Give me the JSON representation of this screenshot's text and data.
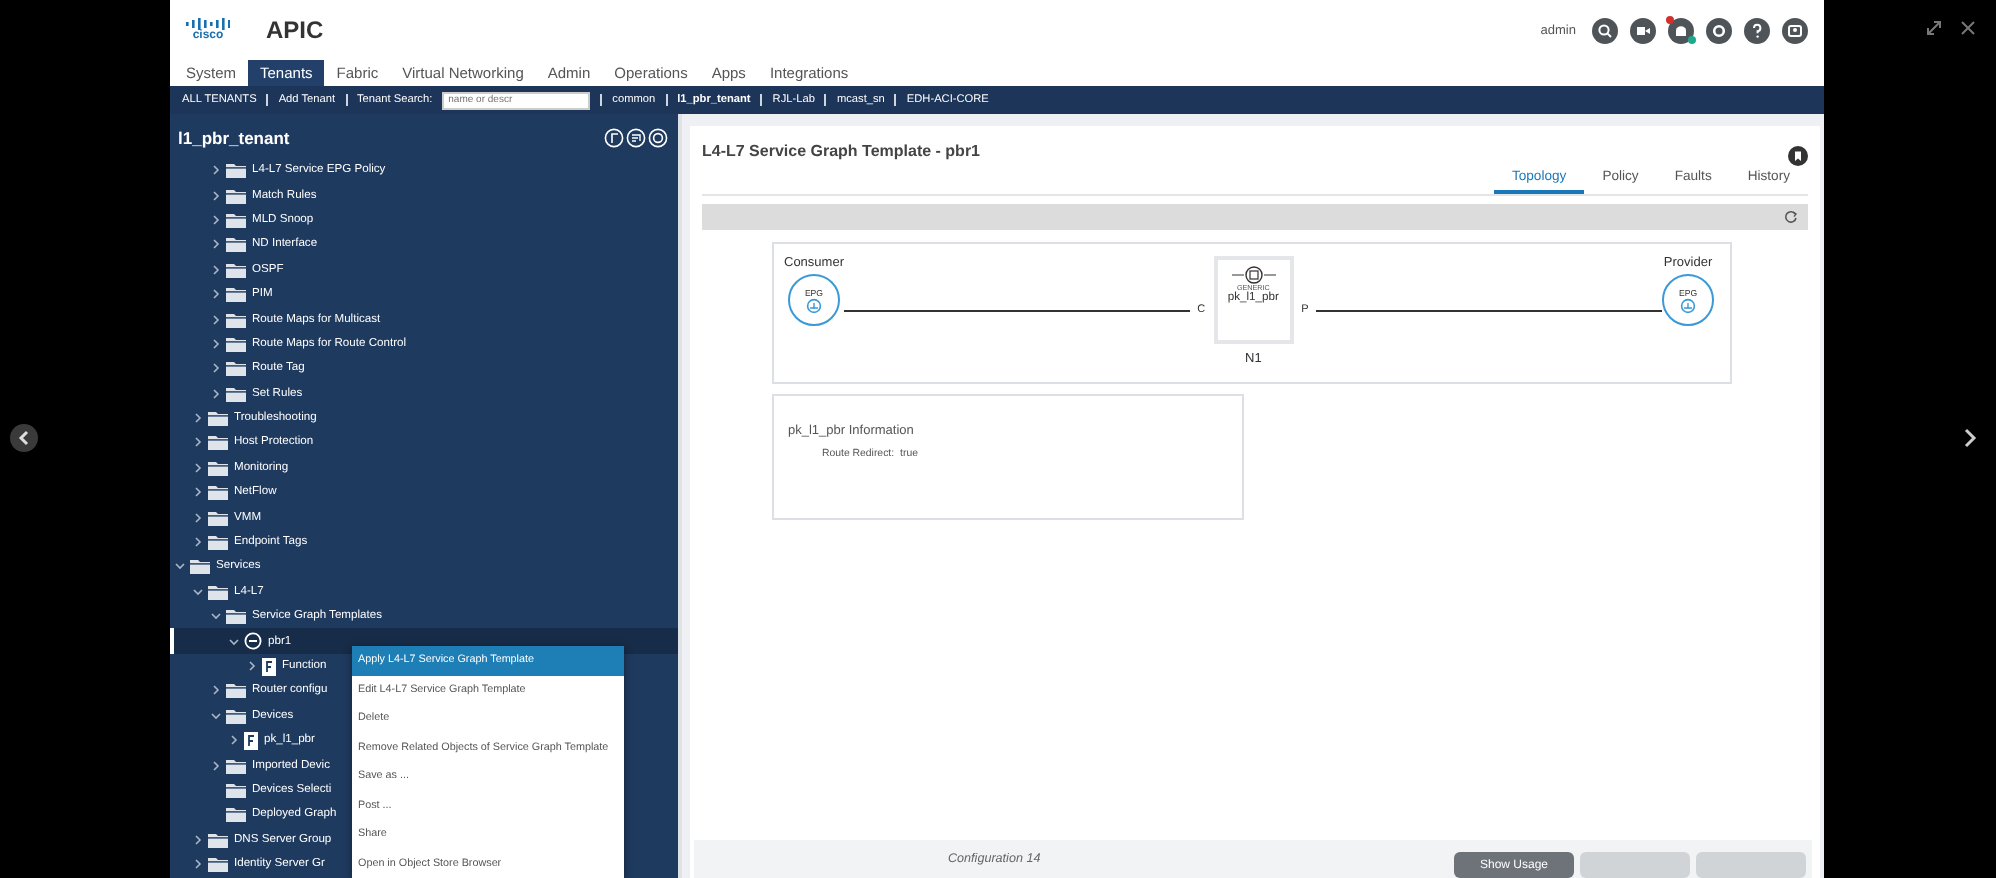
{
  "player": {
    "controls": [
      {
        "kind": "expand"
      },
      {
        "kind": "close"
      },
      {
        "kind": "previous"
      },
      {
        "kind": "next"
      }
    ]
  },
  "header": {
    "logo_text": "cisco",
    "product": "APIC",
    "user": "admin",
    "icons": [
      {
        "kind": "search"
      },
      {
        "kind": "video"
      },
      {
        "kind": "bell"
      },
      {
        "kind": "settings"
      },
      {
        "kind": "help"
      },
      {
        "kind": "user"
      }
    ]
  },
  "tabs": [
    {
      "label": "System",
      "selected": false
    },
    {
      "label": "Tenants",
      "selected": true
    },
    {
      "label": "Fabric",
      "selected": false
    },
    {
      "label": "Virtual Networking",
      "selected": false
    },
    {
      "label": "Admin",
      "selected": false
    },
    {
      "label": "Operations",
      "selected": false
    },
    {
      "label": "Apps",
      "selected": false
    },
    {
      "label": "Integrations",
      "selected": false
    }
  ],
  "tenant_bar": {
    "links": [
      {
        "label": "ALL TENANTS",
        "selected": false
      },
      {
        "label": "Add Tenant",
        "selected": false
      }
    ],
    "search_label": "Tenant Search:",
    "search_placeholder": "name or descr",
    "tenants": [
      {
        "label": "common",
        "selected": false
      },
      {
        "label": "l1_pbr_tenant",
        "selected": true
      },
      {
        "label": "RJL-Lab",
        "selected": false
      },
      {
        "label": "mcast_sn",
        "selected": false
      },
      {
        "label": "EDH-ACI-CORE",
        "selected": false
      }
    ]
  },
  "sidebar": {
    "title": "l1_pbr_tenant",
    "tree": [
      {
        "children": [
          {
            "children": [
              {
                "label": "L4-L7 Service EPG Policy",
                "kind": "folder",
                "expanded": false,
                "selected": false
              },
              {
                "label": "Match Rules",
                "kind": "folder",
                "expanded": false,
                "selected": false
              },
              {
                "label": "MLD Snoop",
                "kind": "folder",
                "expanded": false,
                "selected": false
              },
              {
                "label": "ND Interface",
                "kind": "folder",
                "expanded": false,
                "selected": false
              },
              {
                "label": "OSPF",
                "kind": "folder",
                "expanded": false,
                "selected": false
              },
              {
                "label": "PIM",
                "kind": "folder",
                "expanded": false,
                "selected": false
              },
              {
                "label": "Route Maps for Multicast",
                "kind": "folder",
                "expanded": false,
                "selected": false
              },
              {
                "label": "Route Maps for Route Control",
                "kind": "folder",
                "expanded": false,
                "selected": false
              },
              {
                "label": "Route Tag",
                "kind": "folder",
                "expanded": false,
                "selected": false
              },
              {
                "label": "Set Rules",
                "kind": "folder",
                "expanded": false,
                "selected": false
              }
            ]
          },
          {
            "label": "Troubleshooting",
            "kind": "folder",
            "expanded": false,
            "selected": false
          },
          {
            "label": "Host Protection",
            "kind": "folder",
            "expanded": false,
            "selected": false
          },
          {
            "label": "Monitoring",
            "kind": "folder",
            "expanded": false,
            "selected": false
          },
          {
            "label": "NetFlow",
            "kind": "folder",
            "expanded": false,
            "selected": false
          },
          {
            "label": "VMM",
            "kind": "folder",
            "expanded": false,
            "selected": false
          },
          {
            "label": "Endpoint Tags",
            "kind": "folder",
            "expanded": false,
            "selected": false
          }
        ]
      },
      {
        "label": "Services",
        "kind": "folder",
        "expanded": true,
        "selected": false,
        "children": [
          {
            "label": "L4-L7",
            "kind": "folder",
            "expanded": true,
            "selected": false,
            "children": [
              {
                "label": "Service Graph Templates",
                "kind": "folder",
                "expanded": true,
                "selected": false,
                "children": [
                  {
                    "label": "pbr1",
                    "kind": "template",
                    "expanded": true,
                    "selected": true,
                    "children": [
                      {
                        "label": "Function",
                        "kind": "function",
                        "expanded": false,
                        "selected": false
                      }
                    ]
                  }
                ]
              },
              {
                "label": "Router configu",
                "kind": "folder",
                "expanded": false,
                "selected": false
              },
              {
                "label": "Devices",
                "kind": "folder",
                "expanded": true,
                "selected": false,
                "children": [
                  {
                    "label": "pk_l1_pbr",
                    "kind": "function",
                    "expanded": false,
                    "selected": false
                  }
                ]
              },
              {
                "label": "Imported Devic",
                "kind": "folder",
                "expanded": false,
                "selected": false
              },
              {
                "label": "Devices Selecti",
                "kind": "folder",
                "selected": false
              },
              {
                "label": "Deployed Graph",
                "kind": "folder",
                "selected": false
              }
            ]
          },
          {
            "label": "DNS Server Group",
            "kind": "folder",
            "expanded": false,
            "selected": false
          },
          {
            "label": "Identity Server Gr",
            "kind": "folder",
            "expanded": false,
            "selected": false
          }
        ]
      }
    ]
  },
  "context_menu": [
    {
      "label": "Apply L4-L7 Service Graph Template",
      "selected": true
    },
    {
      "label": "Edit L4-L7 Service Graph Template",
      "selected": false
    },
    {
      "label": "Delete",
      "selected": false
    },
    {
      "label": "Remove Related Objects of Service Graph Template",
      "selected": false
    },
    {
      "label": "Save as ...",
      "selected": false
    },
    {
      "label": "Post ...",
      "selected": false
    },
    {
      "label": "Share",
      "selected": false
    },
    {
      "label": "Open in Object Store Browser",
      "selected": false
    }
  ],
  "content": {
    "title": "L4-L7 Service Graph Template - pbr1",
    "tabs": [
      {
        "label": "Topology",
        "selected": true
      },
      {
        "label": "Policy",
        "selected": false
      },
      {
        "label": "Faults",
        "selected": false
      },
      {
        "label": "History",
        "selected": false
      }
    ],
    "topology": {
      "consumer": {
        "label": "Consumer",
        "node": "EPG"
      },
      "provider": {
        "label": "Provider",
        "node": "EPG"
      },
      "service_node": {
        "type": "GENERIC",
        "name": "pk_l1_pbr",
        "id": "N1",
        "consumer_connector": "C",
        "provider_connector": "P"
      }
    },
    "info": {
      "title": "pk_l1_pbr Information",
      "fields": [
        {
          "label": "Route Redirect:",
          "value": "true"
        }
      ]
    }
  },
  "footer": {
    "status": "Configuration 14",
    "buttons": [
      {
        "label": "Show Usage",
        "disabled": false
      },
      {
        "disabled": true
      },
      {
        "disabled": true
      }
    ]
  }
}
